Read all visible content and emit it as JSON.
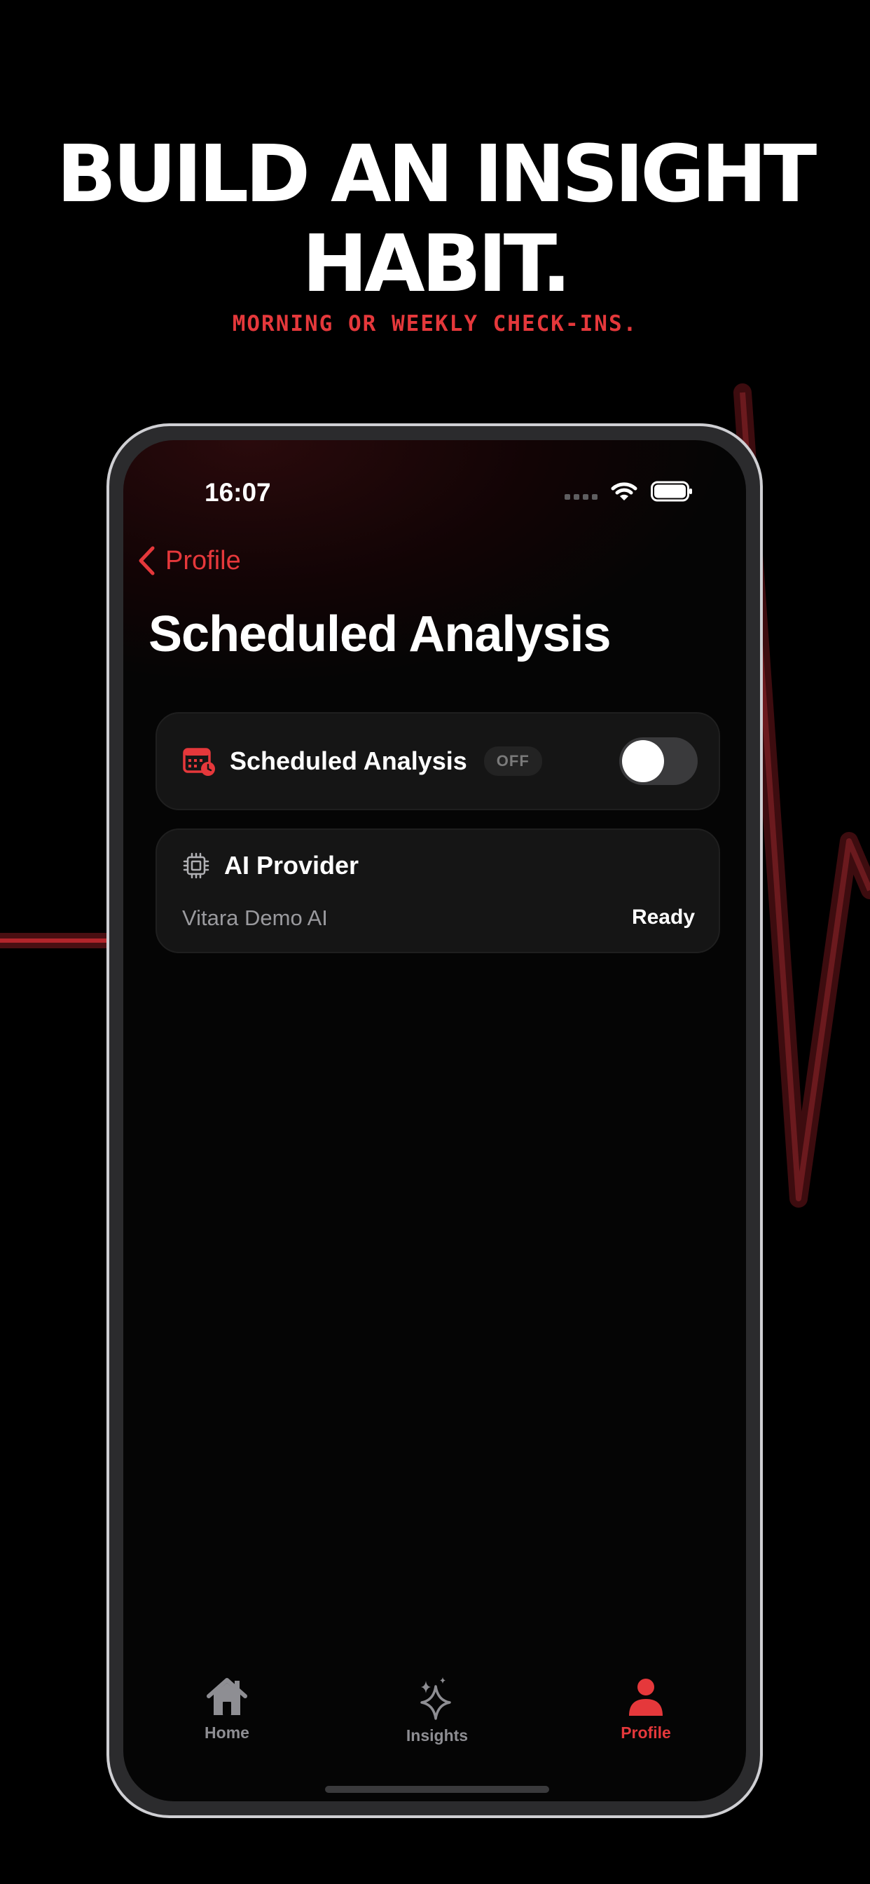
{
  "promo": {
    "headline_line1": "BUILD AN INSIGHT",
    "headline_line2": "HABIT.",
    "subheadline": "MORNING OR WEEKLY CHECK-INS."
  },
  "status_bar": {
    "time": "16:07",
    "icons": [
      "cellular-signal-icon",
      "wifi-icon",
      "battery-icon"
    ]
  },
  "nav": {
    "back_label": "Profile",
    "title": "Scheduled Analysis"
  },
  "scheduled_card": {
    "icon": "calendar-clock-icon",
    "label": "Scheduled Analysis",
    "badge": "OFF",
    "toggle_on": false
  },
  "provider_card": {
    "icon": "cpu-chip-icon",
    "title": "AI Provider",
    "name": "Vitara Demo AI",
    "status": "Ready"
  },
  "tab_bar": {
    "items": [
      {
        "label": "Home",
        "icon": "house-icon",
        "active": false
      },
      {
        "label": "Insights",
        "icon": "sparkles-icon",
        "active": false
      },
      {
        "label": "Profile",
        "icon": "person-icon",
        "active": true
      }
    ]
  },
  "colors": {
    "accent": "#e5383b",
    "background": "#000000",
    "card": "#151515",
    "inactive_tab": "#8e8e93"
  }
}
